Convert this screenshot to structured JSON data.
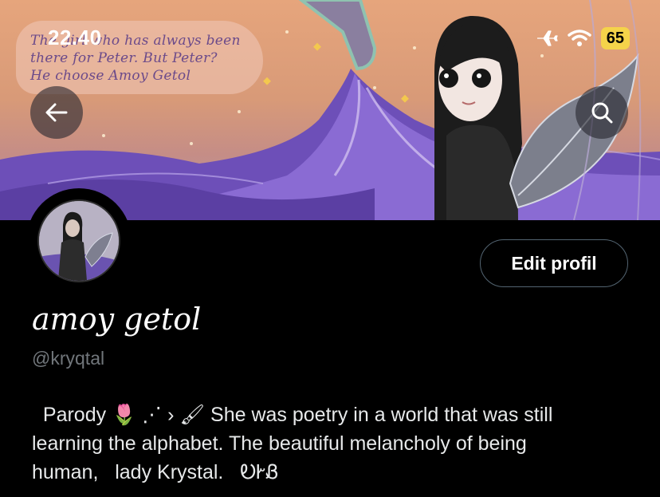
{
  "status_bar": {
    "time": "22.40",
    "battery": "65",
    "icons": [
      "airplane-icon",
      "wifi-icon",
      "battery-icon"
    ]
  },
  "banner": {
    "quote_lines": [
      "The girl who has always been",
      "there for Peter. But Peter?",
      "He choose Amoy Getol"
    ]
  },
  "nav": {
    "back_icon": "arrow-left-icon",
    "search_icon": "search-icon"
  },
  "profile": {
    "edit_button_label": "Edit profil",
    "display_name": "amoy getol",
    "handle": "@kryqtal",
    "bio_lines": [
      "  Parody 🌷 ⋰ › 🖌 She was poetry in a world that was still",
      "learning the alphabet. The beautiful melancholy of being",
      "human,   lady Krystal.   ᎧᎨᏰ"
    ]
  },
  "colors": {
    "background": "#000000",
    "text_primary": "#e7e9ea",
    "text_secondary": "#71767b",
    "battery_badge": "#f5d34a",
    "banner_purple": "#7b5bc4"
  }
}
